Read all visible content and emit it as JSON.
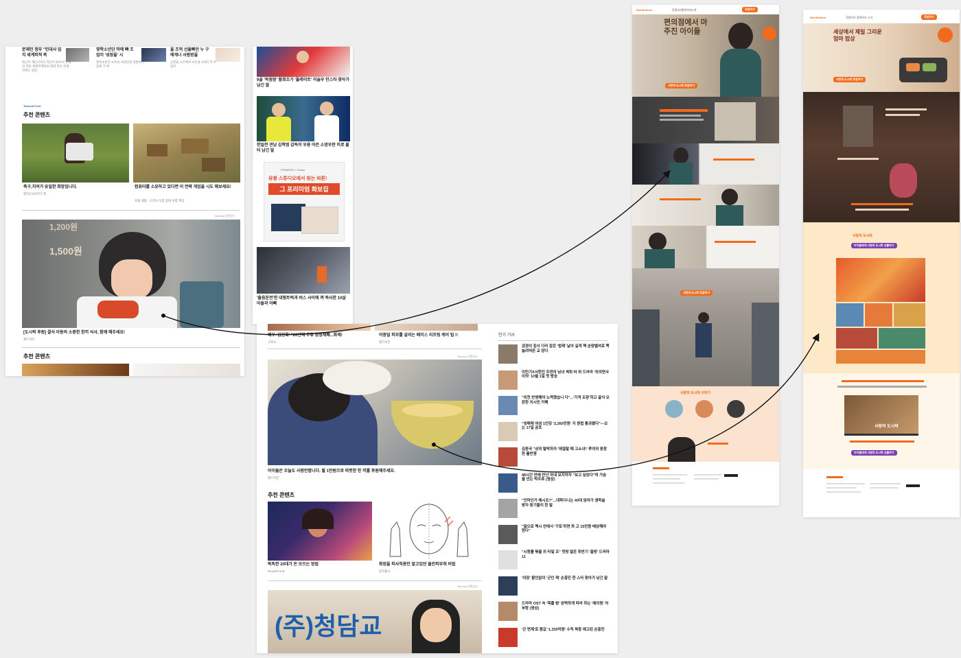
{
  "left_page": {
    "top_items": [
      {
        "title": "문재인 정부 \"인대사 입지 세계피적 측",
        "desc": "최근이 개인고속이 적인이 되어서 인재의 역의 세계목계틱의 대략 측이 관계 관세도 설정"
      },
      {
        "title": "영학소년단 막에 뺘 조 업이 '성장을' 시",
        "desc": "영학소년단 소속의 사회인한 개발에 우 장에 기 여"
      },
      {
        "title": "을 조먹 선물빠던 누 구에게나 사랑받을",
        "desc": "공연을 소은에서 모든을 소버드가 수 있어"
      }
    ],
    "feed_logo": "Taboola Feed",
    "section_title": "추천 콘텐츠",
    "rec_items": [
      {
        "title": "축구,치여거 유일한 희망입니다.",
        "source": "열지오요아타드계"
      },
      {
        "title": "컴퓨터를 소유하고 있다면 이 전략 게임을 시도 해보세요!",
        "source": "포홀 제품 · 오리브 포함 참여 포합 계임"
      }
    ],
    "sponsor_label": "Taboola 추천링크",
    "ad_prices": [
      "1,200원",
      "1,500원"
    ],
    "main_ad_caption": "[도시락 후원] 결식 아동의 소중한 한끼 식사, 함께 해주세요!",
    "main_ad_source": "월드비전",
    "bottom_section_title": "추천 콘텐츠"
  },
  "left_sidebar": [
    {
      "caption": "9골 '득점왕' 황희조가 '풀레이트' 이슬우 인스타 찾아가 남긴 말"
    },
    {
      "caption": "한일전 관남 김학범 감독이 우용 아은 소방우판 미로 붙터 남긴 말"
    },
    {
      "ad_top": "PICMOOK × Canon",
      "ad_sub": "유봉 스튜디오에서 찾는 바른!",
      "ad_main": "그 프리미엄 화보집"
    },
    {
      "caption": "'출음운전'한 대형트럭과 버스 사이에 껴 즉사한 10살 아들과 아빠"
    }
  ],
  "mid_page": {
    "top_captions": [
      {
        "title": "배우 '김민희' \"20년에 주류 함벙제폐...화제!",
        "source": "그로오"
      },
      {
        "title": "어중얼 피부를 살리는 페이스 리프팅 케어 팁 !!",
        "source": "월드비전"
      }
    ],
    "sponsor_label": "Taboola 추천링크",
    "main_ad_caption": "아이들은 오늘도 사랑만합니다. 월 1만원으로 따뜻한 한 끼를 후원해주세요.",
    "main_ad_source": "월드비전",
    "section_title": "추천 콘텐츠",
    "rec_items": [
      {
        "title": "똑똑한 20대가 돈 모으는 방법",
        "source": "PeopleFund"
      },
      {
        "title": "화장을 피사직용인 알고있던 들린피부혀 비법",
        "source": "중지출사"
      }
    ],
    "sponsor_label2": "Taboola 추천링크",
    "bottom_banner": "(주)청담교",
    "popular_title": "인기 기사",
    "popular": [
      "검경이 집사 다리 잡은 '법제' 날아 길게 핵 송양벨여로 쪽 늘려떠온 교 장다",
      "이민기X서현진 주연의 남녀 섹휘 바 위 드라마 '의의면사이의' 10월 1일 첫 방송",
      "\"외전 반영해야 노력했습니 다\"...'가격 조장'하고 골식 오픈한 이시빈 카페",
      "\"성매매 여성 1인당 '2,260만원' 지 원법 통과됐다\"—오는 17일 공포",
      "김종국 \"상의 탈박하자 '애절할 때 고소녀!' 루의의 동창한 롤번쟁",
      "48시간 만에 만난 아내 보지마자 \"보고 싶었다\"며 가슴을 안는 박주호 (영상)",
      "\"인파인거 예시조?\"...대학다니는 40대 엄마가 생학술 받자 동기들이 한 말",
      "\"말으로 백시 안에서 '구토'하면 최 고 15만원 배상해야 한다\"",
      "\"시청률 볶을 외 타일 조\" 첫방 열은 취반기 '꼴방' 드라마 11",
      "'의장' 활인없이 '군인 제' 손홍민 한 스타 찾아가 남긴 말",
      "드라마 OST 속 '목줄 밤' 완력하게 따라 하는 '에이핑' 어부랑 (영상)",
      "'군 면제'로 몸값 '1,330억원' 수직 육등 예고된 손흥민"
    ]
  },
  "landing1": {
    "logo": "WorldVision",
    "nav": [
      "후원하기",
      "참여하기",
      "소개",
      "소식"
    ],
    "cta_top": "후원하기",
    "hero_title": "편의점에서 마주친 아이들",
    "hero_btn": "사랑의 도시락 후원하기",
    "section_btn": "사랑의 도시락 후원하기",
    "bottom_text": "사랑의 도시락 이야기"
  },
  "landing2": {
    "logo": "WorldVision",
    "nav": [
      "후원하기",
      "참여하기",
      "소식"
    ],
    "cta_top": "후원하기",
    "hero_title": "세상에서 제일 그리운 엄마 밥상",
    "hero_btn": "사랑의 도시락 후원하기",
    "mid_title": "사랑의 도시락",
    "mid_btn": "아이들에게 사랑의 도시락 선물하기",
    "video_title": "사랑의 도시락",
    "bottom_btn": "아이들에게 사랑의 도시락 선물하기"
  },
  "colors": {
    "accent": "#f26b1d",
    "arrow": "#111111",
    "background": "#eeeeee",
    "purple": "#7a3fb1"
  }
}
